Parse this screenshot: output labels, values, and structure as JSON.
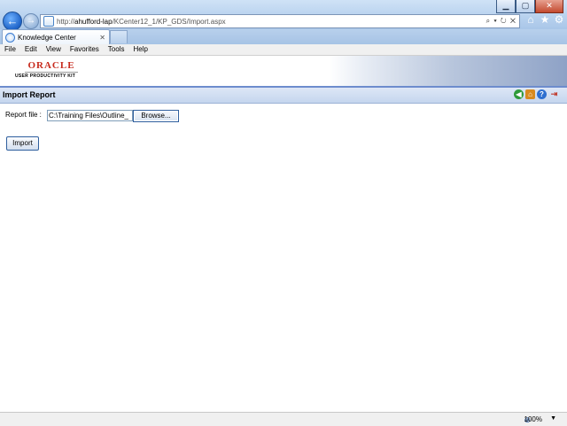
{
  "browser": {
    "url_prefix": "http://",
    "url_host": "ahufford-lap",
    "url_path": "/KCenter12_1/KP_GDS/Import.aspx",
    "address_tools": "⌕ ▾ ↻ ✕",
    "tab_title": "Knowledge Center",
    "tab_close": "✕",
    "menu": [
      "File",
      "Edit",
      "View",
      "Favorites",
      "Tools",
      "Help"
    ],
    "window_controls": {
      "minimize": "▁",
      "maximize": "▢",
      "close": "✕"
    },
    "icons": {
      "home": "⌂",
      "favorites": "★",
      "tools": "⚙"
    }
  },
  "header": {
    "brand": "ORACLE",
    "product": "USER PRODUCTIVITY KIT"
  },
  "page": {
    "title": "Import Report",
    "report_file_label": "Report file :",
    "file_value": "C:\\Training Files\\Outline_",
    "browse_label": "Browse...",
    "import_label": "Import"
  },
  "status": {
    "zoom": "100%"
  },
  "colors": {
    "accent": "#6d8ccd",
    "oracle_red": "#c72b1e"
  }
}
